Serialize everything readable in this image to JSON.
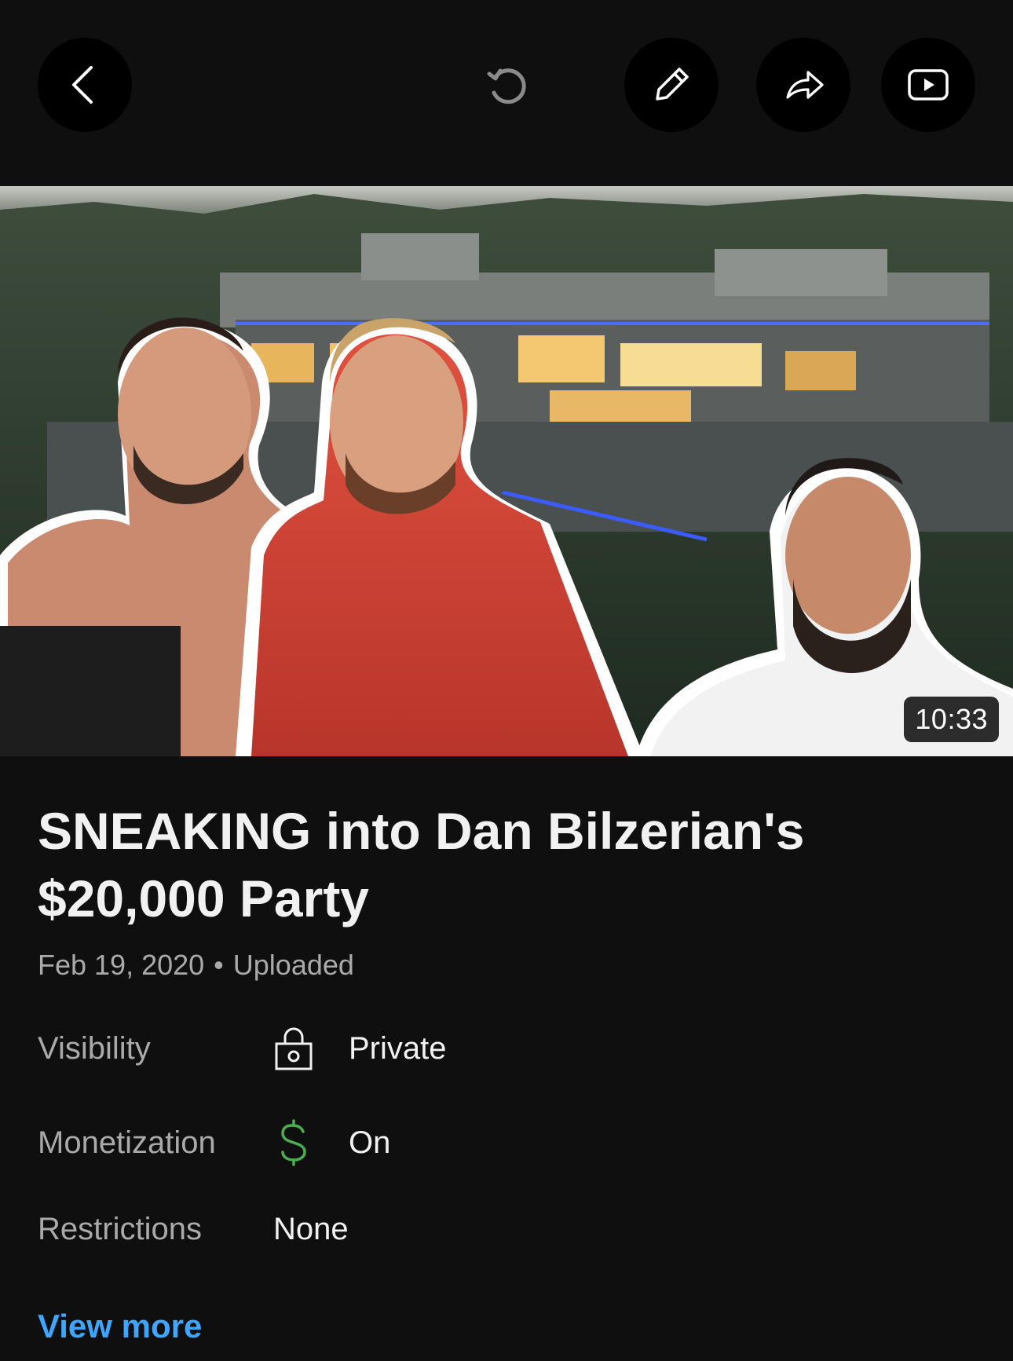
{
  "toolbar": {
    "back_icon": "chevron-left-icon",
    "refresh_icon": "refresh-icon",
    "edit_icon": "pencil-icon",
    "share_icon": "share-arrow-icon",
    "youtube_icon": "youtube-icon"
  },
  "video": {
    "duration": "10:33",
    "title": "SNEAKING into Dan Bilzerian's $20,000 Party",
    "date": "Feb 19, 2020",
    "separator": "•",
    "status": "Uploaded"
  },
  "details": {
    "visibility": {
      "label": "Visibility",
      "icon": "lock-icon",
      "value": "Private"
    },
    "monetization": {
      "label": "Monetization",
      "icon": "dollar-icon",
      "value": "On",
      "icon_color": "#4caf50"
    },
    "restrictions": {
      "label": "Restrictions",
      "value": "None"
    }
  },
  "view_more": "View more",
  "colors": {
    "link": "#3ea6ff",
    "background": "#0f0f0f"
  }
}
